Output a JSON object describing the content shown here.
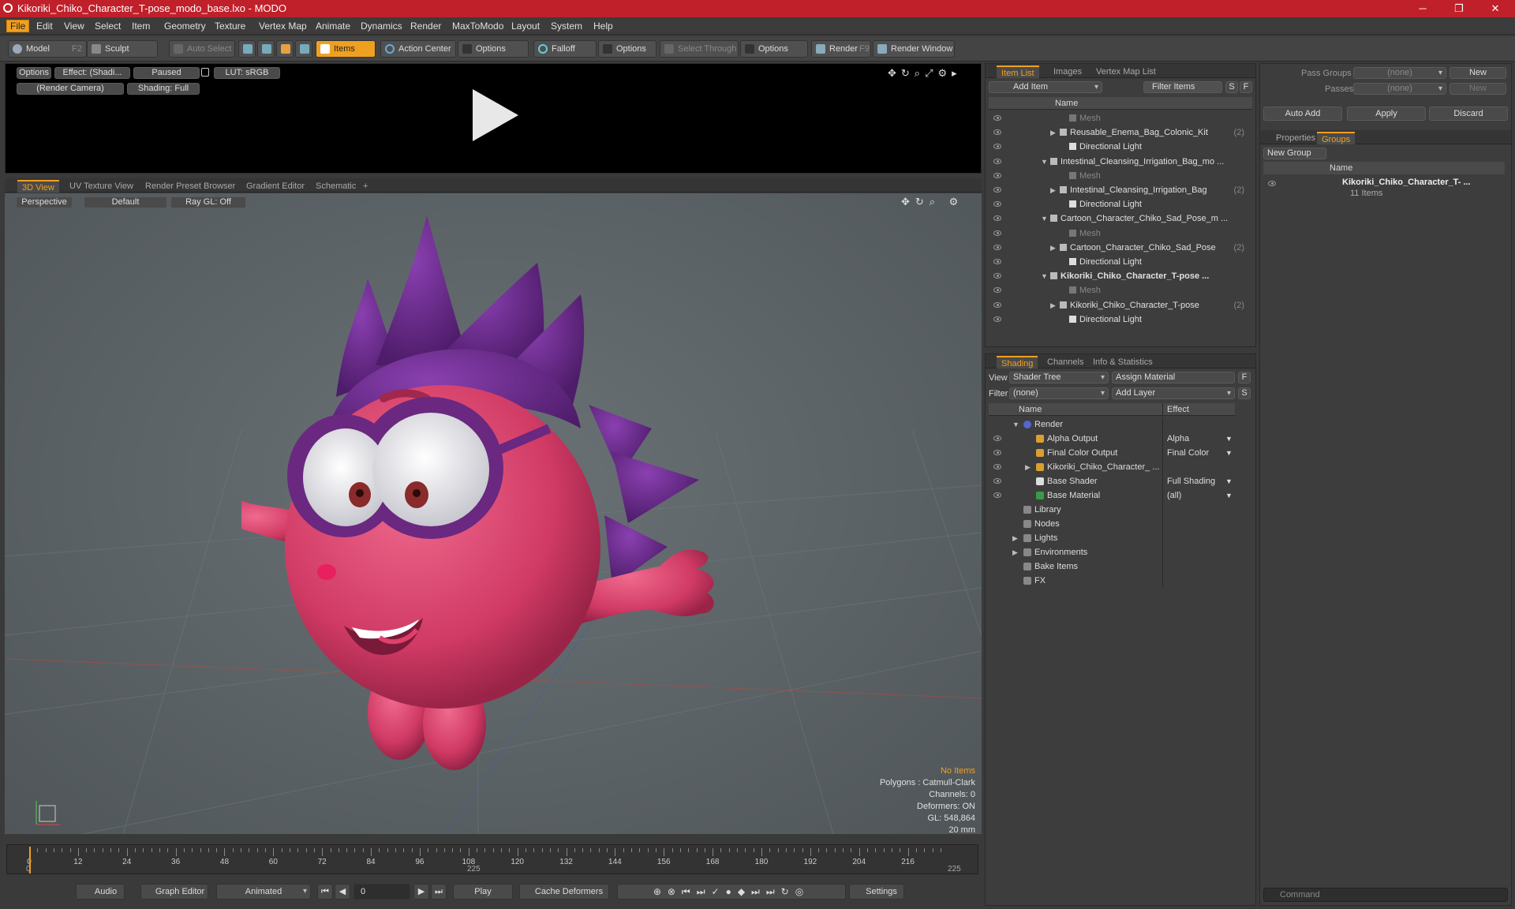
{
  "title": "Kikoriki_Chiko_Character_T-pose_modo_base.lxo - MODO",
  "window_controls": {
    "minimize": "─",
    "maximize": "❐",
    "close": "✕"
  },
  "menu": [
    "File",
    "Edit",
    "View",
    "Select",
    "Item",
    "Geometry",
    "Texture",
    "Vertex Map",
    "Animate",
    "Dynamics",
    "Render",
    "MaxToModo",
    "Layout",
    "System",
    "Help"
  ],
  "toolbar": {
    "model": "Model",
    "model_key": "F2",
    "sculpt": "Sculpt",
    "auto_select": "Auto Select",
    "items": "Items",
    "action_center": "Action Center",
    "options1": "Options",
    "falloff": "Falloff",
    "options2": "Options",
    "select_through": "Select Through",
    "options3": "Options",
    "render": "Render",
    "render_key": "F9",
    "render_window": "Render Window"
  },
  "render_preview": {
    "options": "Options",
    "effect": "Effect: (Shadi...",
    "paused": "Paused",
    "lut": "LUT: sRGB",
    "camera": "(Render Camera)",
    "shading": "Shading: Full"
  },
  "viewport_tabs": [
    "3D View",
    "UV Texture View",
    "Render Preset Browser",
    "Gradient Editor",
    "Schematic"
  ],
  "viewport": {
    "perspective": "Perspective",
    "default": "Default",
    "raygl": "Ray GL: Off",
    "stats": {
      "no_items": "No Items",
      "polygons": "Polygons : Catmull-Clark",
      "channels": "Channels: 0",
      "deformers": "Deformers: ON",
      "gl": "GL: 548,864",
      "scale": "20 mm"
    }
  },
  "timeline": {
    "ticks": [
      "0",
      "12",
      "24",
      "36",
      "48",
      "60",
      "72",
      "84",
      "96",
      "108",
      "120",
      "132",
      "144",
      "156",
      "168",
      "180",
      "192",
      "204",
      "216"
    ],
    "start": "0",
    "mid": "225",
    "end": "225"
  },
  "bottom_bar": {
    "audio": "Audio",
    "graph_editor": "Graph Editor",
    "animated": "Animated",
    "frame": "0",
    "play": "Play",
    "cache": "Cache Deformers",
    "settings": "Settings"
  },
  "item_list": {
    "tabs": [
      "Item List",
      "Images",
      "Vertex Map List"
    ],
    "add_item": "Add Item",
    "filter": "Filter Items",
    "s": "S",
    "f": "F",
    "col_name": "Name",
    "rows": [
      {
        "indent": 3,
        "label": "Mesh",
        "dim": true
      },
      {
        "indent": 2,
        "label": "Reusable_Enema_Bag_Colonic_Kit",
        "count": "(2)",
        "expand": true
      },
      {
        "indent": 3,
        "label": "Directional Light"
      },
      {
        "indent": 1,
        "label": "Intestinal_Cleansing_Irrigation_Bag_mo ...",
        "open": true
      },
      {
        "indent": 3,
        "label": "Mesh",
        "dim": true
      },
      {
        "indent": 2,
        "label": "Intestinal_Cleansing_Irrigation_Bag",
        "count": "(2)",
        "expand": true
      },
      {
        "indent": 3,
        "label": "Directional Light"
      },
      {
        "indent": 1,
        "label": "Cartoon_Character_Chiko_Sad_Pose_m ...",
        "open": true
      },
      {
        "indent": 3,
        "label": "Mesh",
        "dim": true
      },
      {
        "indent": 2,
        "label": "Cartoon_Character_Chiko_Sad_Pose",
        "count": "(2)",
        "expand": true
      },
      {
        "indent": 3,
        "label": "Directional Light"
      },
      {
        "indent": 1,
        "label": "Kikoriki_Chiko_Character_T-pose ...",
        "open": true,
        "bold": true
      },
      {
        "indent": 3,
        "label": "Mesh",
        "dim": true
      },
      {
        "indent": 2,
        "label": "Kikoriki_Chiko_Character_T-pose",
        "count": "(2)",
        "expand": true
      },
      {
        "indent": 3,
        "label": "Directional Light"
      }
    ]
  },
  "shading": {
    "tabs": [
      "Shading",
      "Channels",
      "Info & Statistics"
    ],
    "view_label": "View",
    "view_value": "Shader Tree",
    "assign": "Assign Material",
    "f": "F",
    "filter_label": "Filter",
    "filter_value": "(none)",
    "add_layer": "Add Layer",
    "s": "S",
    "col_name": "Name",
    "col_effect": "Effect",
    "rows": [
      {
        "indent": 0,
        "label": "Render",
        "effect": "",
        "eye": false,
        "open": true
      },
      {
        "indent": 1,
        "label": "Alpha Output",
        "effect": "Alpha",
        "eye": true
      },
      {
        "indent": 1,
        "label": "Final Color Output",
        "effect": "Final Color",
        "eye": true
      },
      {
        "indent": 1,
        "label": "Kikoriki_Chiko_Character_ ...",
        "effect": "",
        "eye": true,
        "expand": true
      },
      {
        "indent": 1,
        "label": "Base Shader",
        "effect": "Full Shading",
        "eye": true
      },
      {
        "indent": 1,
        "label": "Base Material",
        "effect": "(all)",
        "eye": true
      },
      {
        "indent": 0,
        "label": "Library",
        "effect": "",
        "eye": false
      },
      {
        "indent": 0,
        "label": "Nodes",
        "effect": "",
        "eye": false
      },
      {
        "indent": 0,
        "label": "Lights",
        "effect": "",
        "eye": false,
        "expand": true
      },
      {
        "indent": 0,
        "label": "Environments",
        "effect": "",
        "eye": false,
        "expand": true
      },
      {
        "indent": 0,
        "label": "Bake Items",
        "effect": "",
        "eye": false
      },
      {
        "indent": 0,
        "label": "FX",
        "effect": "",
        "eye": false
      }
    ]
  },
  "right_panel": {
    "pass_groups": "Pass Groups",
    "pass_groups_value": "(none)",
    "new": "New",
    "passes": "Passes",
    "passes_value": "(none)",
    "new2": "New",
    "auto_add": "Auto Add",
    "apply": "Apply",
    "discard": "Discard",
    "tabs": [
      "Properties",
      "Groups"
    ],
    "new_group": "New Group",
    "col_name": "Name",
    "group_name": "Kikoriki_Chiko_Character_T- ...",
    "group_count": "11 Items",
    "command": "Command"
  },
  "colors": {
    "accent": "#f0a020",
    "titlebar": "#c0202a",
    "viewport_bg": "#5b6266",
    "character": "#d8456e",
    "spikes": "#6a2a8a"
  }
}
